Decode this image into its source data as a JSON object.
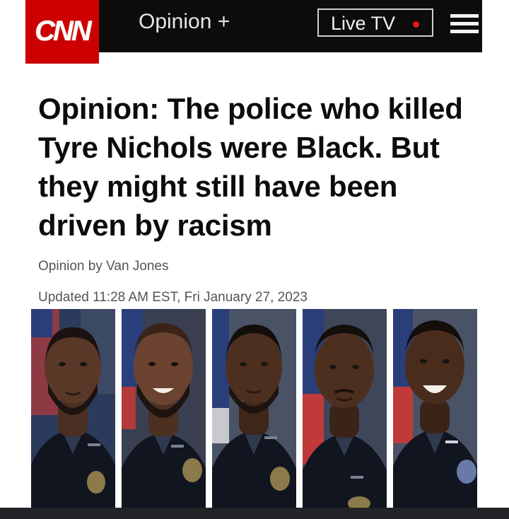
{
  "nav": {
    "logo_text": "CNN",
    "section": "Opinion +",
    "live_label": "Live TV",
    "menu_icon": "hamburger-menu-icon",
    "brand_color": "#cc0000"
  },
  "article": {
    "headline": "Opinion: The police who killed Tyre Nichols were Black. But they might still have been driven by racism",
    "byline": "Opinion by Van Jones",
    "timestamp": "Updated 11:28 AM EST, Fri January 27, 2023"
  },
  "photo_strip": {
    "count": 5
  }
}
